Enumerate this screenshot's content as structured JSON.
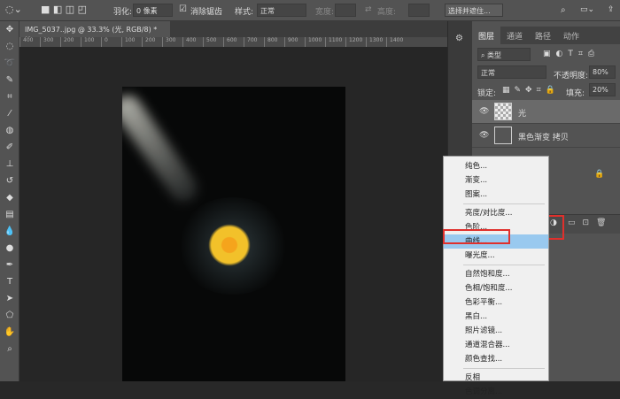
{
  "options_bar": {
    "feather_label": "羽化:",
    "feather_value": "0 像素",
    "antialias_label": "消除锯齿",
    "style_label": "样式:",
    "style_value": "正常",
    "width_label": "宽度:",
    "height_label": "高度:",
    "select_mask_button": "选择并遮住..."
  },
  "document_tab": {
    "title": "IMG_5037..jpg @ 33.3% (光, RGB/8) *",
    "close": "×"
  },
  "ruler": [
    "400",
    "300",
    "200",
    "100",
    "0",
    "100",
    "200",
    "300",
    "400",
    "500",
    "600",
    "700",
    "800",
    "900",
    "1000",
    "1100",
    "1200",
    "1300",
    "1400"
  ],
  "panel": {
    "tabs": [
      "图层",
      "通道",
      "路径",
      "动作"
    ],
    "filter_value": "类型",
    "blend_mode": "正常",
    "opacity_label": "不透明度:",
    "opacity_value": "80%",
    "lock_label": "锁定:",
    "fill_label": "填充:",
    "fill_value": "20%",
    "layers": [
      {
        "name": "光",
        "selected": true
      },
      {
        "name": "黑色渐变 拷贝",
        "selected": false
      }
    ]
  },
  "menu": {
    "groups": [
      [
        "纯色...",
        "渐变...",
        "图案..."
      ],
      [
        "亮度/对比度...",
        "色阶...",
        "曲线...",
        "曝光度..."
      ],
      [
        "自然饱和度...",
        "色相/饱和度...",
        "色彩平衡...",
        "黑白...",
        "照片滤镜...",
        "通道混合器...",
        "颜色查找..."
      ],
      [
        "反相",
        "色调分离..."
      ]
    ],
    "highlighted": "曲线..."
  },
  "colors": {
    "highlight": "#99c9ef",
    "annotation": "#e0302c"
  }
}
